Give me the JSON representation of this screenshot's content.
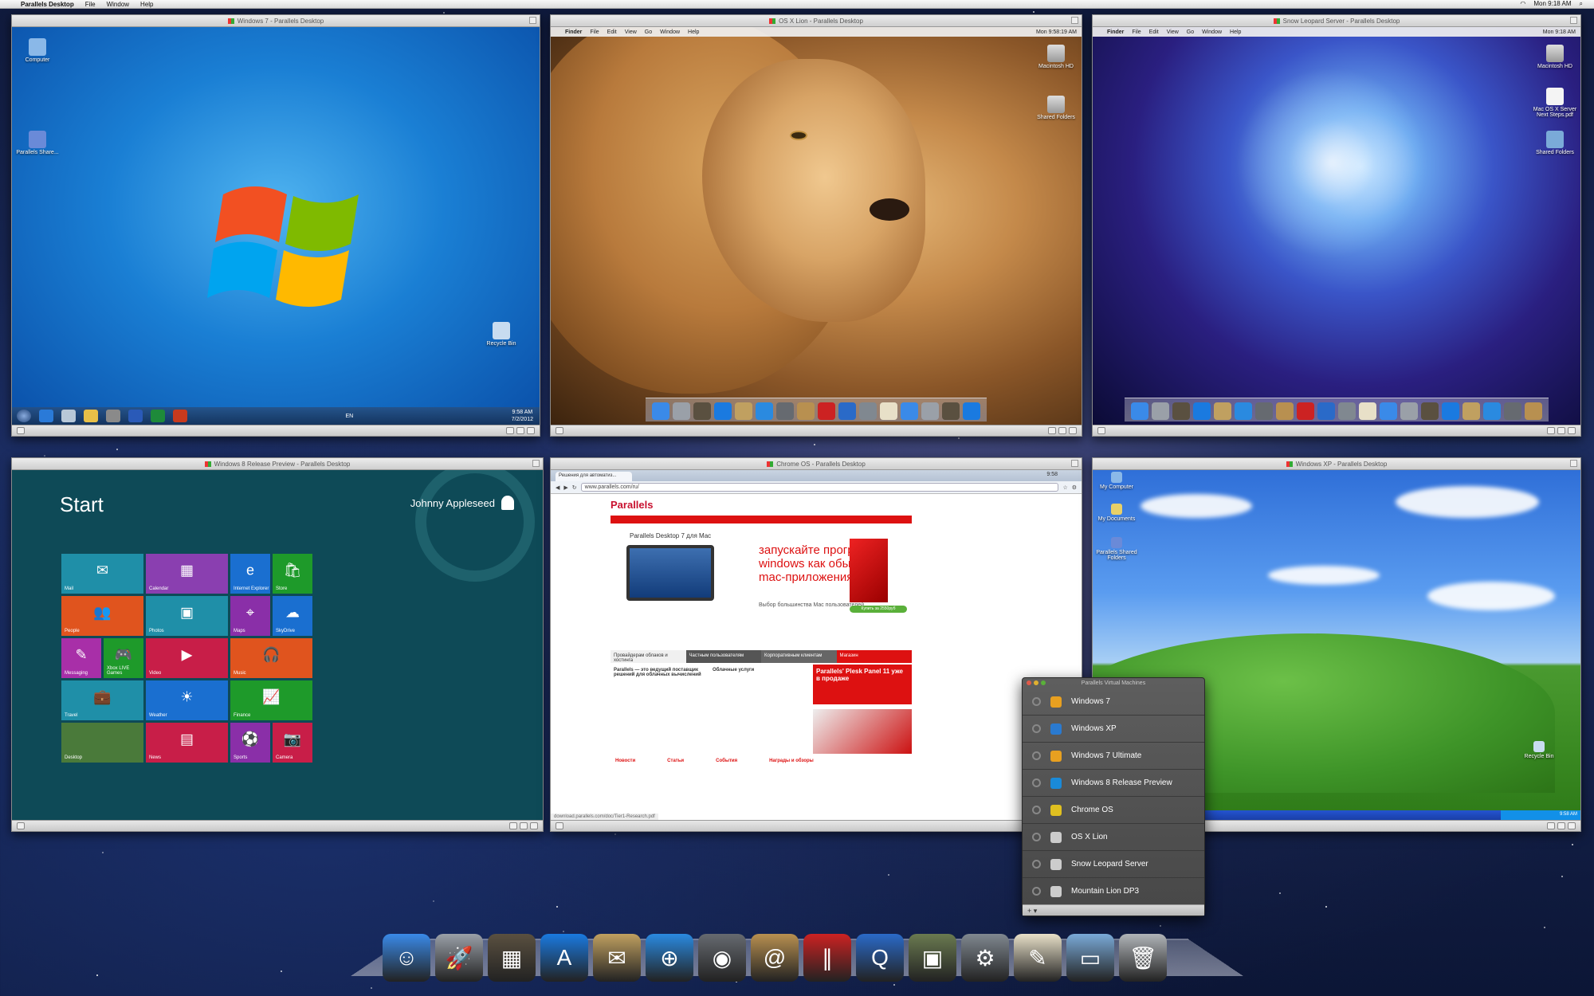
{
  "menubar": {
    "app": "Parallels Desktop",
    "items": [
      "File",
      "Window",
      "Help"
    ],
    "clock": "Mon 9:18 AM"
  },
  "windows": {
    "win7": {
      "title": "Windows 7 - Parallels Desktop",
      "icons": [
        "Computer",
        "Parallels Share...",
        "Recycle Bin"
      ],
      "clock_time": "9:58 AM",
      "clock_date": "7/2/2012",
      "lang": "EN"
    },
    "lion": {
      "title": "OS X Lion - Parallels Desktop",
      "menu": [
        "Finder",
        "File",
        "Edit",
        "View",
        "Go",
        "Window",
        "Help"
      ],
      "clock": "Mon 9:58:19 AM",
      "icons": [
        "Macintosh HD",
        "Shared Folders"
      ]
    },
    "snow": {
      "title": "Snow Leopard Server - Parallels Desktop",
      "menu": [
        "Finder",
        "File",
        "Edit",
        "View",
        "Go",
        "Window",
        "Help"
      ],
      "clock": "Mon 9:18 AM",
      "icons": [
        "Macintosh HD",
        "Mac OS X Server Next Steps.pdf",
        "Shared Folders"
      ]
    },
    "win8": {
      "title": "Windows 8 Release Preview - Parallels Desktop",
      "start": "Start",
      "user": "Johnny Appleseed",
      "tiles": [
        {
          "label": "Mail",
          "color": "#1f8fa8",
          "icon": "✉",
          "wide": true
        },
        {
          "label": "Calendar",
          "color": "#8a3fb0",
          "icon": "▦",
          "wide": true
        },
        {
          "label": "Internet Explorer",
          "color": "#1a6fd0",
          "icon": "e",
          "wide": false
        },
        {
          "label": "Store",
          "color": "#1e9a2a",
          "icon": "🛍",
          "wide": false
        },
        {
          "label": "People",
          "color": "#e0541e",
          "icon": "👥",
          "wide": true
        },
        {
          "label": "Photos",
          "color": "#1f8fa8",
          "icon": "▣",
          "wide": true
        },
        {
          "label": "Maps",
          "color": "#8a2fa8",
          "icon": "⌖",
          "wide": false
        },
        {
          "label": "SkyDrive",
          "color": "#1a6fd0",
          "icon": "☁",
          "wide": false
        },
        {
          "label": "Messaging",
          "color": "#a82fa8",
          "icon": "✎",
          "wide": false
        },
        {
          "label": "Xbox LIVE Games",
          "color": "#1e9a2a",
          "icon": "🎮",
          "wide": false
        },
        {
          "label": "Video",
          "color": "#c81e48",
          "icon": "▶",
          "wide": true
        },
        {
          "label": "Music",
          "color": "#e0541e",
          "icon": "🎧",
          "wide": true
        },
        {
          "label": "Travel",
          "color": "#1f8fa8",
          "icon": "💼",
          "wide": true
        },
        {
          "label": "Weather",
          "color": "#1a6fd0",
          "icon": "☀",
          "wide": true
        },
        {
          "label": "Finance",
          "color": "#1e9a2a",
          "icon": "📈",
          "wide": true
        },
        {
          "label": "Desktop",
          "color": "#4a7a3a",
          "icon": "",
          "wide": true
        },
        {
          "label": "News",
          "color": "#c81e48",
          "icon": "▤",
          "wide": true
        },
        {
          "label": "Sports",
          "color": "#8a2fa8",
          "icon": "⚽",
          "wide": false
        },
        {
          "label": "Camera",
          "color": "#c81e48",
          "icon": "📷",
          "wide": false
        }
      ]
    },
    "chrome": {
      "title": "Chrome OS - Parallels Desktop",
      "tab": "Решения для автоматиз...",
      "url": "www.parallels.com/ru/",
      "time": "9:58",
      "logo": "Parallels",
      "hero_title": "Parallels Desktop 7 для Mac",
      "hero_text": "запускайте программы windows как обычные mac-приложения",
      "hero_sub": "Выбор большинства Mac пользователей",
      "buy_btn": "Купить за 2550руб",
      "tabs": [
        "Провайдерам облаков и хостинга",
        "Частным пользователям",
        "Корпоративным клиентам",
        "Магазин"
      ],
      "col1_title": "Parallels — это ведущий поставщик решений для облачных вычислений",
      "col2_title": "Облачные услуги",
      "promo": "Parallels' Plesk Panel 11 уже в продаже",
      "footer": [
        "Новости",
        "Статьи",
        "События",
        "Награды и обзоры"
      ],
      "status": "download.parallels.com/doc/Tier1-Research.pdf"
    },
    "xp": {
      "title": "Windows XP - Parallels Desktop",
      "icons": [
        "My Computer",
        "My Documents",
        "Parallels Shared Folders",
        "Recycle Bin"
      ],
      "clock": "9:58 AM"
    }
  },
  "vm_panel": {
    "title": "Parallels Virtual Machines",
    "items": [
      {
        "name": "Windows 7",
        "icon": "windows-icon",
        "color": "#e8a020"
      },
      {
        "name": "Windows XP",
        "icon": "windows-icon",
        "color": "#2a7ad0"
      },
      {
        "name": "Windows 7 Ultimate",
        "icon": "windows-icon",
        "color": "#e8a020"
      },
      {
        "name": "Windows 8 Release Preview",
        "icon": "windows8-icon",
        "color": "#1a8ad8"
      },
      {
        "name": "Chrome OS",
        "icon": "chrome-icon",
        "color": "#e0c020"
      },
      {
        "name": "OS X Lion",
        "icon": "apple-icon",
        "color": "#cccccc"
      },
      {
        "name": "Snow Leopard Server",
        "icon": "apple-icon",
        "color": "#cccccc"
      },
      {
        "name": "Mountain Lion DP3",
        "icon": "apple-icon",
        "color": "#cccccc"
      }
    ]
  },
  "dock": {
    "items": [
      {
        "name": "finder-icon",
        "color": "#3a8ae8",
        "sym": "☺"
      },
      {
        "name": "launchpad-icon",
        "color": "#9aa0a8",
        "sym": "🚀"
      },
      {
        "name": "mission-control-icon",
        "color": "#5a5040",
        "sym": "▦"
      },
      {
        "name": "app-store-icon",
        "color": "#1a7ae0",
        "sym": "A"
      },
      {
        "name": "mail-icon",
        "color": "#c0a060",
        "sym": "✉"
      },
      {
        "name": "safari-icon",
        "color": "#2a8ae0",
        "sym": "⊕"
      },
      {
        "name": "facetime-icon",
        "color": "#666a70",
        "sym": "◉"
      },
      {
        "name": "address-book-icon",
        "color": "#b89050",
        "sym": "@"
      },
      {
        "name": "parallels-icon",
        "color": "#cc2222",
        "sym": "∥"
      },
      {
        "name": "quicktime-icon",
        "color": "#2a6ac8",
        "sym": "Q"
      },
      {
        "name": "iphoto-icon",
        "color": "#6a7a50",
        "sym": "▣"
      },
      {
        "name": "system-preferences-icon",
        "color": "#808890",
        "sym": "⚙"
      },
      {
        "name": "textedit-icon",
        "color": "#e8e0c8",
        "sym": "✎"
      },
      {
        "name": "folder-icon",
        "color": "#7aaad8",
        "sym": "▭"
      },
      {
        "name": "trash-icon",
        "color": "#b0b4b8",
        "sym": "🗑"
      }
    ]
  }
}
